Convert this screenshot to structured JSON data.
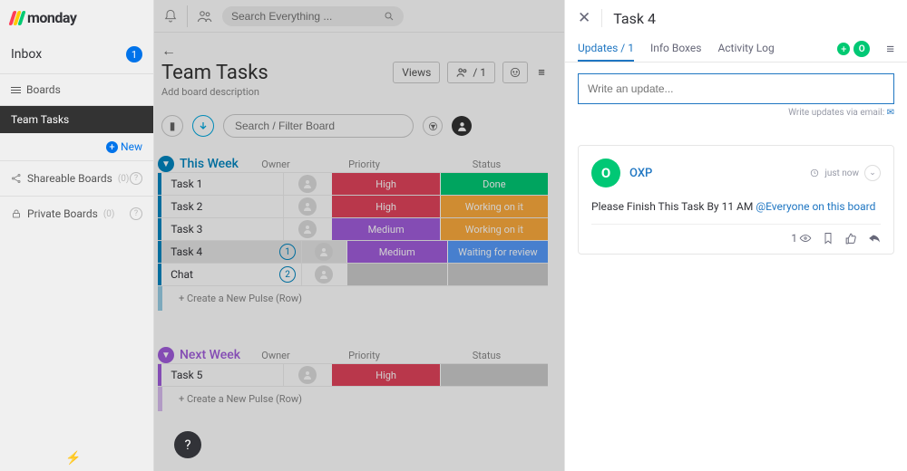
{
  "logo": "monday",
  "sidebar": {
    "inbox_label": "Inbox",
    "inbox_count": "1",
    "boards_label": "Boards",
    "active_board": "Team Tasks",
    "new_label": "New",
    "shareable_label": "Shareable Boards",
    "shareable_count": "(0)",
    "private_label": "Private Boards",
    "private_count": "(0)"
  },
  "topbar": {
    "search_placeholder": "Search Everything ..."
  },
  "board": {
    "title": "Team Tasks",
    "desc": "Add board description",
    "views_btn": "Views",
    "people_btn": "/ 1",
    "filter_placeholder": "Search / Filter Board"
  },
  "columns": {
    "owner": "Owner",
    "priority": "Priority",
    "status": "Status"
  },
  "groups": [
    {
      "name": "This Week",
      "color": "blue",
      "rows": [
        {
          "name": "Task 1",
          "priority": "High",
          "p_class": "c-high",
          "status": "Done",
          "s_class": "c-done",
          "bubbles": ""
        },
        {
          "name": "Task 2",
          "priority": "High",
          "p_class": "c-high",
          "status": "Working on it",
          "s_class": "c-working",
          "bubbles": ""
        },
        {
          "name": "Task 3",
          "priority": "Medium",
          "p_class": "c-medium",
          "status": "Working on it",
          "s_class": "c-working",
          "bubbles": ""
        },
        {
          "name": "Task 4",
          "priority": "Medium",
          "p_class": "c-medium",
          "status": "Waiting for review",
          "s_class": "c-waiting",
          "bubbles": "1",
          "selected": true
        },
        {
          "name": "Chat",
          "priority": "",
          "p_class": "c-empty",
          "status": "",
          "s_class": "c-empty",
          "bubbles": "2"
        }
      ],
      "new_pulse": "+ Create a New Pulse (Row)"
    },
    {
      "name": "Next Week",
      "color": "purple",
      "rows": [
        {
          "name": "Task 5",
          "priority": "High",
          "p_class": "c-high",
          "status": "",
          "s_class": "c-empty",
          "bubbles": ""
        }
      ],
      "new_pulse": "+ Create a New Pulse (Row)"
    }
  ],
  "panel": {
    "title": "Task 4",
    "tabs": {
      "updates": "Updates / 1",
      "info": "Info Boxes",
      "activity": "Activity Log"
    },
    "avatar_letter": "O",
    "update_placeholder": "Write an update...",
    "via_email_text": "Write updates via email:",
    "author_initial": "O",
    "author_name": "OXP",
    "timestamp": "just now",
    "body_text": "Please Finish This Task By 11 AM ",
    "mention": "@Everyone on this board",
    "seen_count": "1"
  }
}
